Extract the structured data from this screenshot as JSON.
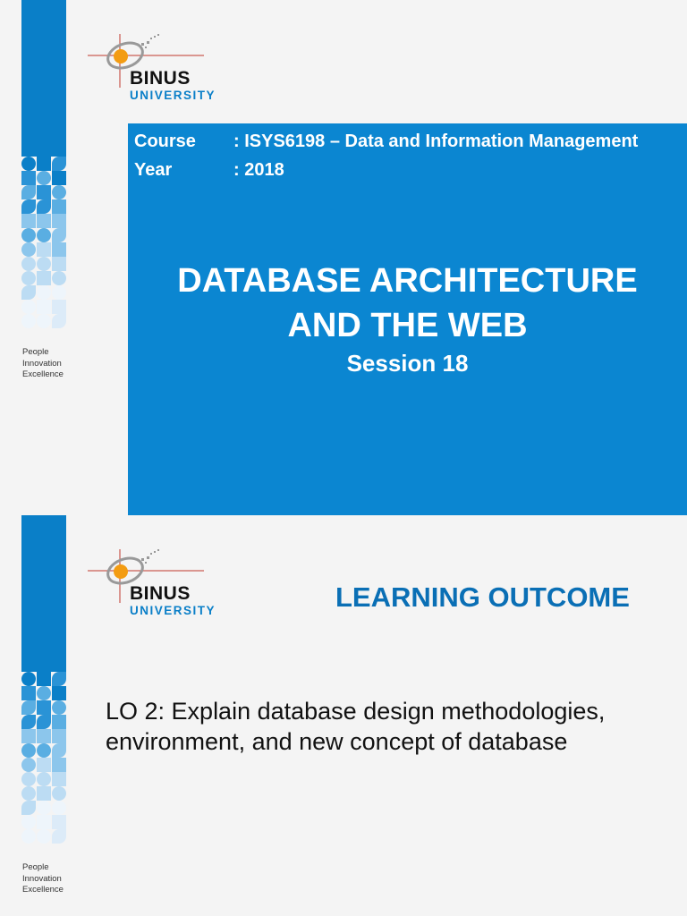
{
  "brand": {
    "logo_name": "BINUS",
    "logo_sub": "UNIVERSITY",
    "tagline": [
      "People",
      "Innovation",
      "Excellence"
    ],
    "colors": {
      "primary_blue": "#0b86d1",
      "accent_orange": "#f39c12",
      "heading_blue": "#0a6fb5"
    }
  },
  "slide1": {
    "course_label": "Course",
    "course_value": ": ISYS6198 – Data and Information Management",
    "year_label": "Year",
    "year_value": ": 2018",
    "title_line1": "DATABASE ARCHITECTURE",
    "title_line2": "AND THE WEB",
    "session": "Session  18"
  },
  "slide2": {
    "heading": "LEARNING OUTCOME",
    "outcome": "LO 2: Explain database design methodologies, environment, and new concept of database"
  }
}
